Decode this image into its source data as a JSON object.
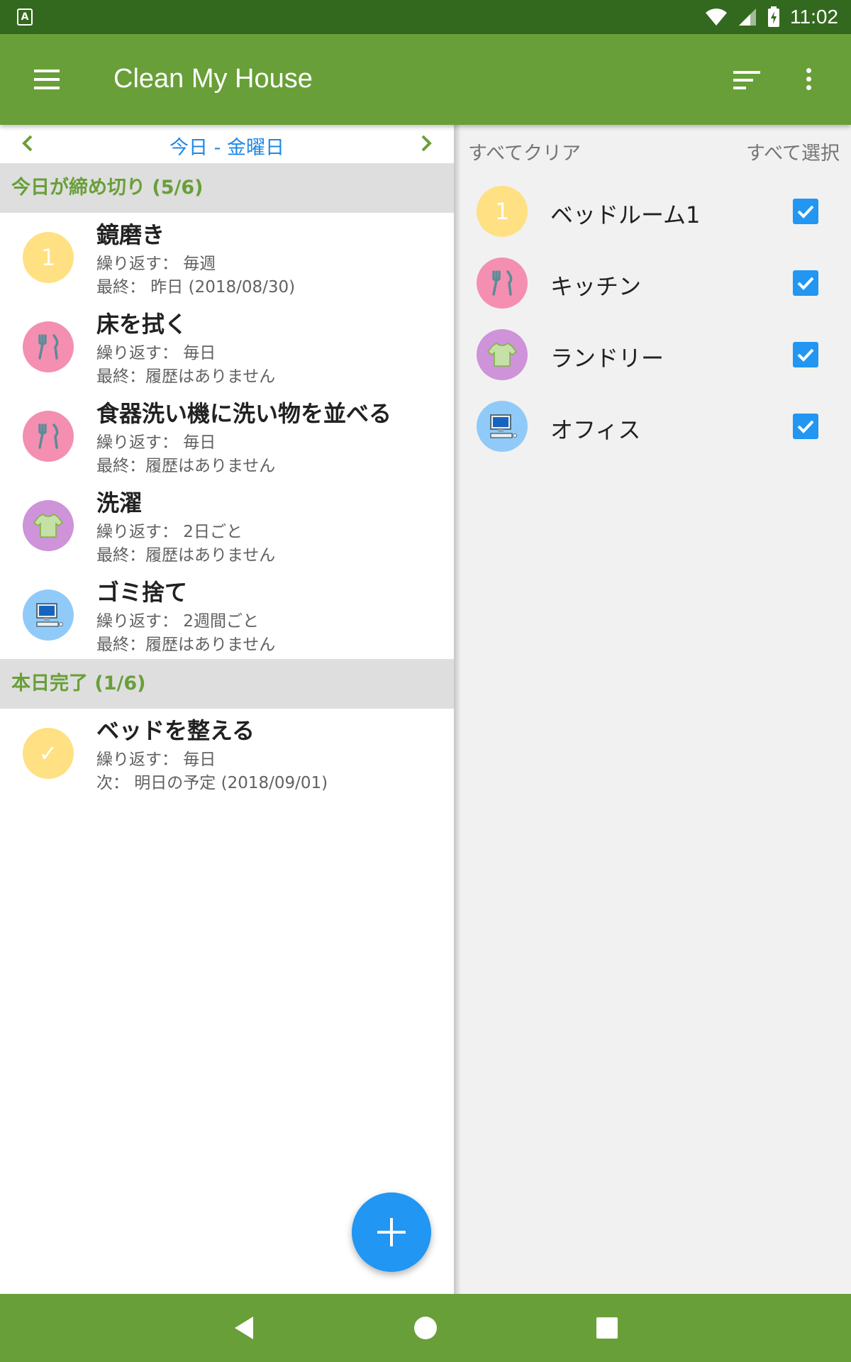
{
  "status_bar": {
    "time": "11:02",
    "notification_icon": "A"
  },
  "app_bar": {
    "title": "Clean My House"
  },
  "date_nav": {
    "label": "今日 - 金曜日"
  },
  "sections": {
    "due_today": "今日が締め切り (5/6)",
    "done_today": "本日完了 (1/6)"
  },
  "tasks_due": [
    {
      "title": "鏡磨き",
      "line1": "繰り返す： 毎週",
      "line2": "最終： 昨日 (2018/08/30)",
      "avatar_text": "1",
      "avatar_color": "#ffe082",
      "icon": "number-one-icon"
    },
    {
      "title": "床を拭く",
      "line1": "繰り返す： 毎日",
      "line2": "最終：履歴はありません",
      "avatar_color": "#f48fb1",
      "icon": "fork-knife-icon"
    },
    {
      "title": "食器洗い機に洗い物を並べる",
      "line1": "繰り返す： 毎日",
      "line2": "最終：履歴はありません",
      "avatar_color": "#f48fb1",
      "icon": "fork-knife-icon"
    },
    {
      "title": "洗濯",
      "line1": "繰り返す： 2日ごと",
      "line2": "最終：履歴はありません",
      "avatar_color": "#ce93d8",
      "icon": "tshirt-icon"
    },
    {
      "title": "ゴミ捨て",
      "line1": "繰り返す： 2週間ごと",
      "line2": "最終：履歴はありません",
      "avatar_color": "#90caf9",
      "icon": "computer-icon"
    }
  ],
  "tasks_done": [
    {
      "title": "ベッドを整える",
      "line1": "繰り返す： 毎日",
      "line2": "次： 明日の予定 (2018/09/01)",
      "avatar_text": "✓",
      "avatar_color": "#ffe082",
      "icon": "checkmark-icon"
    }
  ],
  "filter": {
    "clear_all": "すべてクリア",
    "select_all": "すべて選択",
    "rooms": [
      {
        "label": "ベッドルーム1",
        "avatar_text": "1",
        "avatar_color": "#ffe082",
        "checked": true,
        "icon": "number-one-icon"
      },
      {
        "label": "キッチン",
        "avatar_color": "#f48fb1",
        "checked": true,
        "icon": "fork-knife-icon"
      },
      {
        "label": "ランドリー",
        "avatar_color": "#ce93d8",
        "checked": true,
        "icon": "tshirt-icon"
      },
      {
        "label": "オフィス",
        "avatar_color": "#90caf9",
        "checked": true,
        "icon": "computer-icon"
      }
    ]
  },
  "colors": {
    "status_bar": "#33691e",
    "primary": "#689f38",
    "accent": "#2196f3",
    "section_bg": "#dedede"
  }
}
